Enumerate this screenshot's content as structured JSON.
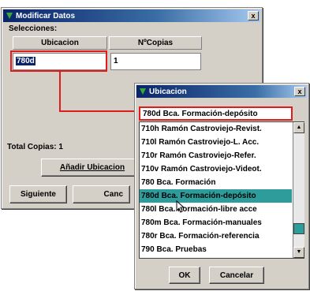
{
  "main_dialog": {
    "title": "Modificar Datos",
    "close_label": "x",
    "selections_label": "Selecciones:",
    "columns": [
      "Ubicacion",
      "NºCopias"
    ],
    "row": {
      "ubicacion": "780d",
      "copias": "1"
    },
    "total_label": "Total Copias: 1",
    "add_button": "Añadir Ubicacion",
    "next_button": "Siguiente",
    "cancel_button_partial": "Canc"
  },
  "popup": {
    "title": "Ubicacion",
    "close_label": "x",
    "field_value": "780d  Bca. Formación-depósito",
    "items": [
      "710h  Ramón Castroviejo-Revist.",
      "710l  Ramón Castroviejo-L. Acc.",
      "710r  Ramón Castroviejo-Refer.",
      "710v  Ramón Castroviejo-Videot.",
      "780  Bca. Formación",
      "780d  Bca. Formación-depósito",
      "780l  Bca. Formación-libre acce",
      "780m  Bca. Formación-manuales",
      "780r  Bca. Formación-referencia",
      "790  Bca. Pruebas"
    ],
    "selected_index": 5,
    "ok_button": "OK",
    "cancel_button": "Cancelar"
  },
  "colors": {
    "highlight_box": "#e01b1b",
    "selected_item": "#2f9c9c",
    "title_gradient_start": "#0a246a"
  },
  "icons": {
    "title": "java-logo-icon",
    "cursor": "mouse-pointer-icon"
  }
}
